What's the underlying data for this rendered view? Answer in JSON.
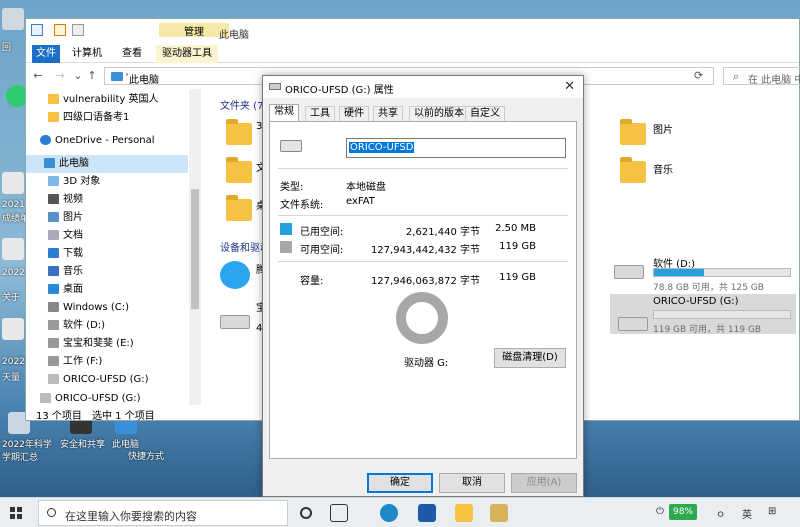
{
  "desktop": {
    "labels": [
      "回",
      "2021",
      "成绩单",
      "2022",
      "关于",
      "2022",
      "天量",
      "2022年科学学期汇总",
      "安全和共享",
      "此电脑",
      "快捷方式"
    ]
  },
  "explorer": {
    "window_title": "此电脑",
    "context_tab": "管理",
    "ribbon_tabs": [
      "文件",
      "计算机",
      "查看",
      "驱动器工具"
    ],
    "address_path": "此电脑",
    "search_placeholder": "在 此电脑 中",
    "nav_items": [
      {
        "label": "vulnerability 英国人",
        "icon": "folder-icon"
      },
      {
        "label": "四级口语备考1",
        "icon": "folder-icon"
      },
      {
        "label": "OneDrive - Personal",
        "icon": "cloud-icon"
      },
      {
        "label": "此电脑",
        "icon": "computer-icon"
      },
      {
        "label": "3D 对象",
        "icon": "cube-icon"
      },
      {
        "label": "视频",
        "icon": "video-icon"
      },
      {
        "label": "图片",
        "icon": "picture-icon"
      },
      {
        "label": "文档",
        "icon": "document-icon"
      },
      {
        "label": "下载",
        "icon": "download-icon"
      },
      {
        "label": "音乐",
        "icon": "music-icon"
      },
      {
        "label": "桌面",
        "icon": "desktop-icon"
      },
      {
        "label": "Windows (C:)",
        "icon": "windows-drive-icon"
      },
      {
        "label": "软件 (D:)",
        "icon": "drive-icon"
      },
      {
        "label": "宝宝和斐斐 (E:)",
        "icon": "drive-icon"
      },
      {
        "label": "工作 (F:)",
        "icon": "drive-icon"
      },
      {
        "label": "ORICO-UFSD (G:)",
        "icon": "usb-drive-icon"
      },
      {
        "label": "ORICO-UFSD (G:)",
        "icon": "usb-drive-icon"
      }
    ],
    "status_items": "13 个项目",
    "status_selected": "选中 1 个项目",
    "group_folders": "文件夹 (7)",
    "group_devices": "设备和驱动器",
    "folder_partial": [
      "3",
      "文",
      "桌"
    ],
    "folders_right": [
      {
        "label": "图片"
      },
      {
        "label": "音乐"
      }
    ],
    "device_partial": [
      "腾",
      "宝",
      "4"
    ],
    "drives": [
      {
        "name": "软件 (D:)",
        "detail": "78.8 GB 可用，共 125 GB",
        "used_fraction": 0.37
      },
      {
        "name": "ORICO-UFSD (G:)",
        "detail": "119 GB 可用，共 119 GB",
        "used_fraction": 0.0
      }
    ]
  },
  "dialog": {
    "title": "ORICO-UFSD (G:) 属性",
    "tabs": [
      "常规",
      "工具",
      "硬件",
      "共享",
      "以前的版本",
      "自定义"
    ],
    "volume_name": "ORICO-UFSD",
    "type_label": "类型:",
    "type_value": "本地磁盘",
    "fs_label": "文件系统:",
    "fs_value": "exFAT",
    "used_label": "已用空间:",
    "used_bytes": "2,621,440 字节",
    "used_size": "2.50 MB",
    "free_label": "可用空间:",
    "free_bytes": "127,943,442,432 字节",
    "free_size": "119 GB",
    "cap_label": "容量:",
    "cap_bytes": "127,946,063,872 字节",
    "cap_size": "119 GB",
    "drive_label": "驱动器 G:",
    "cleanup_button": "磁盘清理(D)",
    "ok": "确定",
    "cancel": "取消",
    "apply": "应用(A)",
    "colors": {
      "used": "#26a0da",
      "free": "#a7a7a7"
    }
  },
  "taskbar": {
    "search_placeholder": "在这里输入你要搜索的内容",
    "battery": "98%",
    "tray_icons": [
      "ㅇ",
      "英",
      "⊞"
    ]
  }
}
